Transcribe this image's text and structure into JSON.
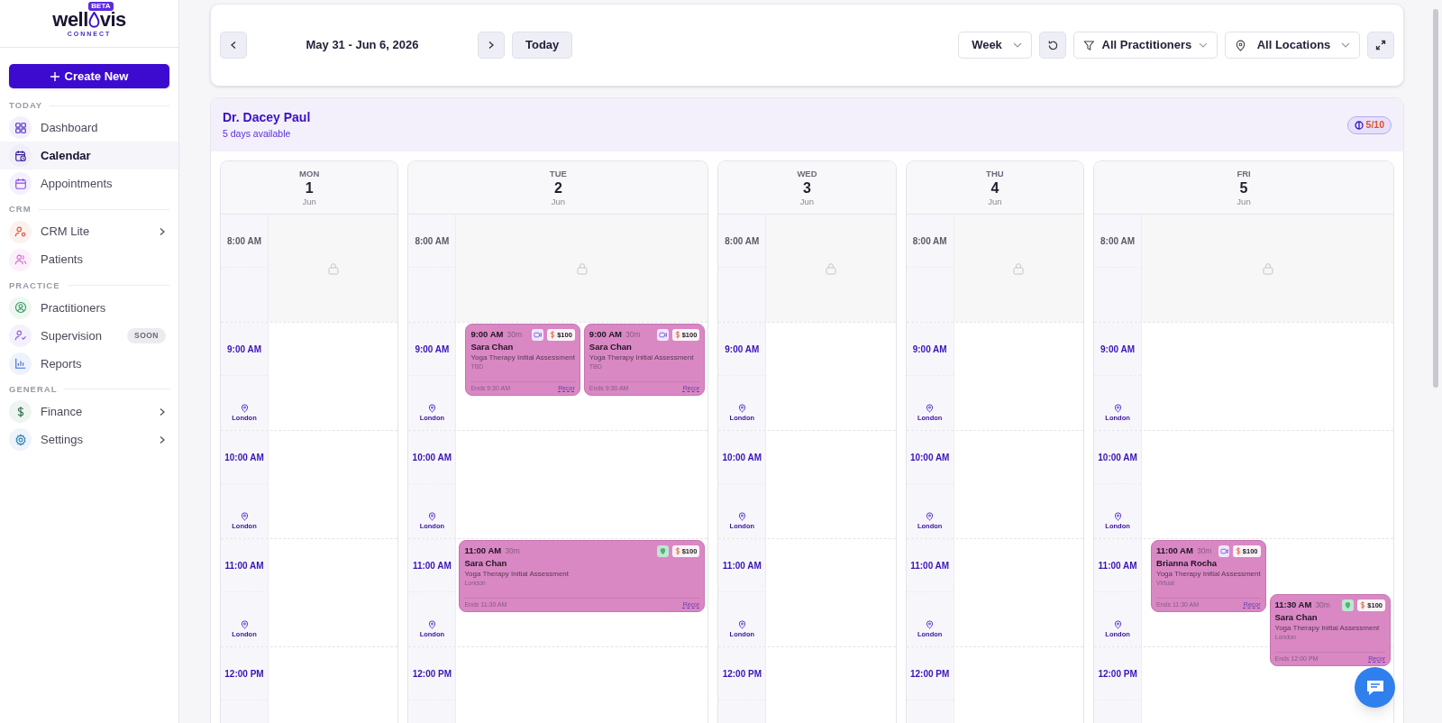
{
  "logo": {
    "left": "well",
    "right": "vis",
    "badge": "BETA",
    "tagline": "CONNECT"
  },
  "create_button": {
    "label": "Create New"
  },
  "nav_sections": [
    {
      "title": "TODAY",
      "items": [
        {
          "label": "Dashboard",
          "selected": false
        },
        {
          "label": "Calendar",
          "selected": true
        },
        {
          "label": "Appointments",
          "selected": false
        }
      ]
    },
    {
      "title": "CRM",
      "items": [
        {
          "label": "CRM Lite",
          "selected": false,
          "submenu": true
        },
        {
          "label": "Patients",
          "selected": false
        }
      ]
    },
    {
      "title": "PRACTICE",
      "items": [
        {
          "label": "Practitioners",
          "selected": false
        },
        {
          "label": "Supervision",
          "selected": false,
          "badge": "SOON"
        },
        {
          "label": "Reports",
          "selected": false
        }
      ]
    },
    {
      "title": "GENERAL",
      "items": [
        {
          "label": "Finance",
          "selected": false,
          "submenu": true
        },
        {
          "label": "Settings",
          "selected": false,
          "submenu": true
        }
      ]
    }
  ],
  "toolbar": {
    "date_range": "May 31 - Jun 6, 2026",
    "today": "Today",
    "view": "Week",
    "practitioners": "All Practitioners",
    "locations": "All Locations"
  },
  "practitioner": {
    "name": "Dr. Dacey Paul",
    "availability": "5 days available",
    "count": "5/10"
  },
  "days": [
    {
      "weekday": "MON",
      "date": "1",
      "month": "Jun",
      "hours": [
        {
          "time": "8:00 AM",
          "locked": true
        },
        {
          "time": "9:00 AM",
          "locked": false,
          "location": "London"
        },
        {
          "time": "10:00 AM",
          "locked": false,
          "location": "London"
        },
        {
          "time": "11:00 AM",
          "locked": false,
          "location": "London"
        },
        {
          "time": "12:00 PM",
          "locked": false
        }
      ]
    },
    {
      "weekday": "TUE",
      "date": "2",
      "month": "Jun",
      "hours": [
        {
          "time": "8:00 AM",
          "locked": true
        },
        {
          "time": "9:00 AM",
          "locked": false,
          "location": "London",
          "halves": [
            {
              "events": [
                {
                  "kind": "video",
                  "start": "9:00 AM",
                  "duration": "30m",
                  "price": "$100",
                  "name": "Sara Chan",
                  "service": "Yoga Therapy Initial Assessment",
                  "place": "TBD",
                  "ends": "Ends 9:30 AM",
                  "action": "Recor"
                },
                {
                  "kind": "video",
                  "start": "9:00 AM",
                  "duration": "30m",
                  "price": "$100",
                  "name": "Sara Chan",
                  "service": "Yoga Therapy Initial Assessment",
                  "place": "TBD",
                  "ends": "Ends 9:30 AM",
                  "action": "Recor"
                }
              ]
            }
          ]
        },
        {
          "time": "10:00 AM",
          "locked": false,
          "location": "London"
        },
        {
          "time": "11:00 AM",
          "locked": false,
          "location": "London",
          "halves": [
            {
              "events": [
                {
                  "kind": "in_person",
                  "start": "11:00 AM",
                  "duration": "30m",
                  "price": "$100",
                  "name": "Sara Chan",
                  "service": "Yoga Therapy Initial Assessment",
                  "place": "London",
                  "ends": "Ends 11:30 AM",
                  "action": "Recor"
                }
              ]
            }
          ]
        },
        {
          "time": "12:00 PM",
          "locked": false
        }
      ]
    },
    {
      "weekday": "WED",
      "date": "3",
      "month": "Jun",
      "hours": [
        {
          "time": "8:00 AM",
          "locked": true
        },
        {
          "time": "9:00 AM",
          "locked": false,
          "location": "London"
        },
        {
          "time": "10:00 AM",
          "locked": false,
          "location": "London"
        },
        {
          "time": "11:00 AM",
          "locked": false,
          "location": "London"
        },
        {
          "time": "12:00 PM",
          "locked": false
        }
      ]
    },
    {
      "weekday": "THU",
      "date": "4",
      "month": "Jun",
      "hours": [
        {
          "time": "8:00 AM",
          "locked": true
        },
        {
          "time": "9:00 AM",
          "locked": false,
          "location": "London"
        },
        {
          "time": "10:00 AM",
          "locked": false,
          "location": "London"
        },
        {
          "time": "11:00 AM",
          "locked": false,
          "location": "London"
        },
        {
          "time": "12:00 PM",
          "locked": false
        }
      ]
    },
    {
      "weekday": "FRI",
      "date": "5",
      "month": "Jun",
      "hours": [
        {
          "time": "8:00 AM",
          "locked": true
        },
        {
          "time": "9:00 AM",
          "locked": false,
          "location": "London"
        },
        {
          "time": "10:00 AM",
          "locked": false,
          "location": "London"
        },
        {
          "time": "11:00 AM",
          "locked": false,
          "location": "London",
          "halves": [
            {
              "events": [
                {
                  "kind": "video",
                  "start": "11:00 AM",
                  "duration": "30m",
                  "price": "$100",
                  "name": "Brianna Rocha",
                  "service": "Yoga Therapy Initial Assessment",
                  "place": "Virtual",
                  "ends": "Ends 11:30 AM",
                  "action": "Recor"
                }
              ]
            },
            {
              "events": [
                {
                  "kind": "in_person",
                  "start": "11:30 AM",
                  "duration": "30m",
                  "price": "$100",
                  "name": "Sara Chan",
                  "service": "Yoga Therapy Initial Assessment",
                  "place": "London",
                  "ends": "Ends 12:00 PM",
                  "action": "Recor"
                }
              ]
            }
          ]
        },
        {
          "time": "12:00 PM",
          "locked": false
        }
      ]
    }
  ]
}
